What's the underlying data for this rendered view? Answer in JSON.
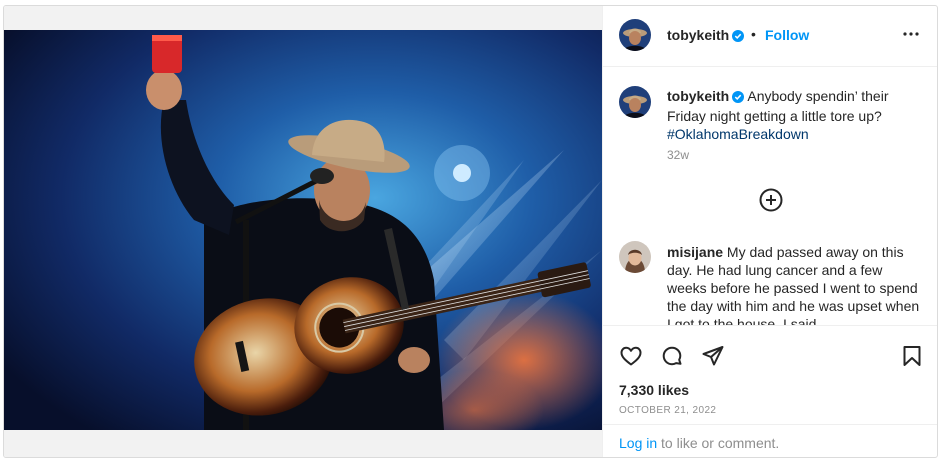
{
  "post": {
    "author": "tobykeith",
    "verified": true,
    "follow_label": "Follow",
    "separator": "•",
    "more_icon": "more-horizontal-icon"
  },
  "caption": {
    "username": "tobykeith",
    "text": " Anybody spendin’ their Friday night getting a little tore up? ",
    "hashtag": "#OklahomaBreakdown",
    "time": "32w"
  },
  "comments": [
    {
      "username": "misijane",
      "text": " My dad passed away on this day. He had lung cancer and a few weeks before he passed I went to spend the day with him and he was upset when I got to the house. I said"
    }
  ],
  "load_more_icon": "plus-circle-icon",
  "actions": {
    "icons": [
      "heart-icon",
      "comment-icon",
      "share-icon",
      "bookmark-icon"
    ],
    "likes": "7,330 likes",
    "date": "OCTOBER 21, 2022"
  },
  "login": {
    "link": "Log in",
    "rest": " to like or comment."
  },
  "colors": {
    "link_blue": "#0095f6",
    "hashtag": "#00376b",
    "secondary_text": "#8e8e8e",
    "border": "#dbdbdb"
  }
}
